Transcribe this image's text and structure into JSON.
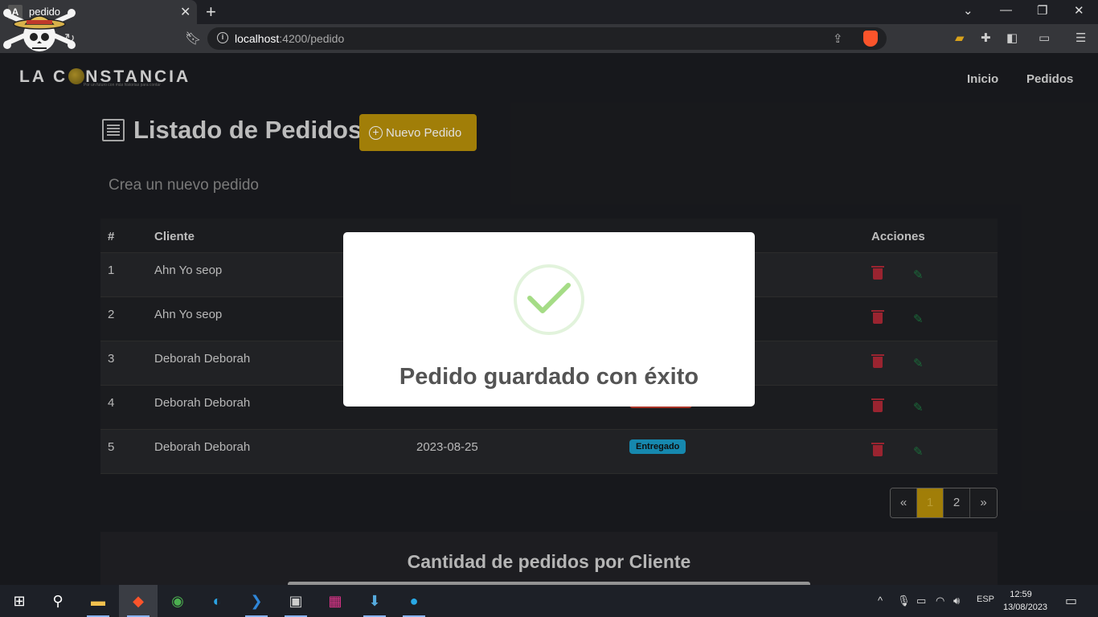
{
  "browser": {
    "tab_title": "pedido",
    "tab_favicon": "A",
    "url_host": "localhost",
    "url_path": ":4200/pedido"
  },
  "navbar": {
    "brand_left": "LA C",
    "brand_right": "NSTANCIA",
    "brand_tagline": "Por un futuro con más historias para contar",
    "links": [
      "Inicio",
      "Pedidos"
    ]
  },
  "page": {
    "title": "Listado de Pedidos",
    "new_button": "Nuevo Pedido",
    "subtitle": "Crea un nuevo pedido"
  },
  "table": {
    "headers": {
      "num": "#",
      "cliente": "Cliente",
      "acciones": "Acciones"
    },
    "rows": [
      {
        "num": "1",
        "cliente": "Ahn Yo seop",
        "fecha": "",
        "estado": ""
      },
      {
        "num": "2",
        "cliente": "Ahn Yo seop",
        "fecha": "",
        "estado": ""
      },
      {
        "num": "3",
        "cliente": "Deborah Deborah",
        "fecha": "",
        "estado": ""
      },
      {
        "num": "4",
        "cliente": "Deborah Deborah",
        "fecha": "",
        "estado": ""
      },
      {
        "num": "5",
        "cliente": "Deborah Deborah",
        "fecha": "2023-08-25",
        "estado": "Entregado"
      }
    ],
    "badge_colors": {
      "entregado": "#1a9bc7",
      "cancelado": "#c0392b"
    }
  },
  "pagination": {
    "prev": "«",
    "pages": [
      "1",
      "2"
    ],
    "next": "»",
    "active_page": "1"
  },
  "chart": {
    "title": "Cantidad de pedidos por Cliente"
  },
  "modal": {
    "message": "Pedido guardado con éxito",
    "icon": "success-check-icon"
  },
  "taskbar": {
    "language": "ESP",
    "time": "12:59",
    "date": "13/08/2023"
  },
  "colors": {
    "accent": "#b8900a",
    "danger": "#b02a37",
    "success": "#a5dc86"
  }
}
